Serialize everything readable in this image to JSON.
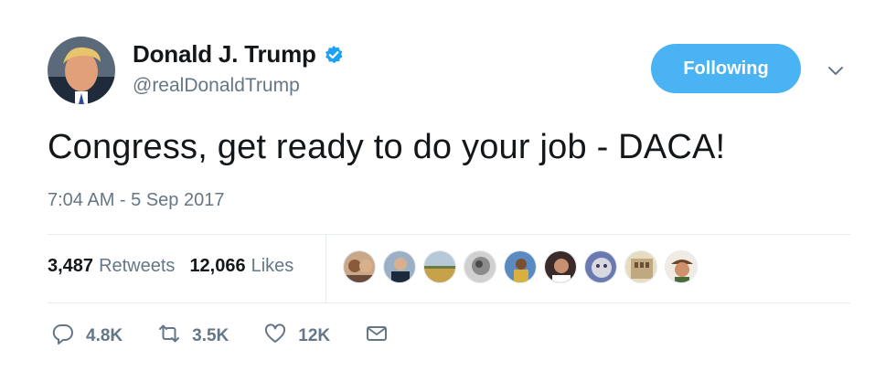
{
  "author": {
    "name": "Donald J. Trump",
    "handle": "@realDonaldTrump",
    "verified_icon": "verified-badge-icon"
  },
  "follow_button": {
    "label": "Following"
  },
  "tweet": {
    "text": "Congress, get ready to do your job - DACA!",
    "timestamp": "7:04 AM - 5 Sep 2017"
  },
  "stats": {
    "retweets_count": "3,487",
    "retweets_label": "Retweets",
    "likes_count": "12,066",
    "likes_label": "Likes"
  },
  "actions": {
    "reply_count": "4.8K",
    "retweet_count": "3.5K",
    "like_count": "12K"
  },
  "colors": {
    "accent": "#4ab3f4",
    "secondary_text": "#657786",
    "primary_text": "#14171a",
    "verified": "#1da1f2"
  }
}
